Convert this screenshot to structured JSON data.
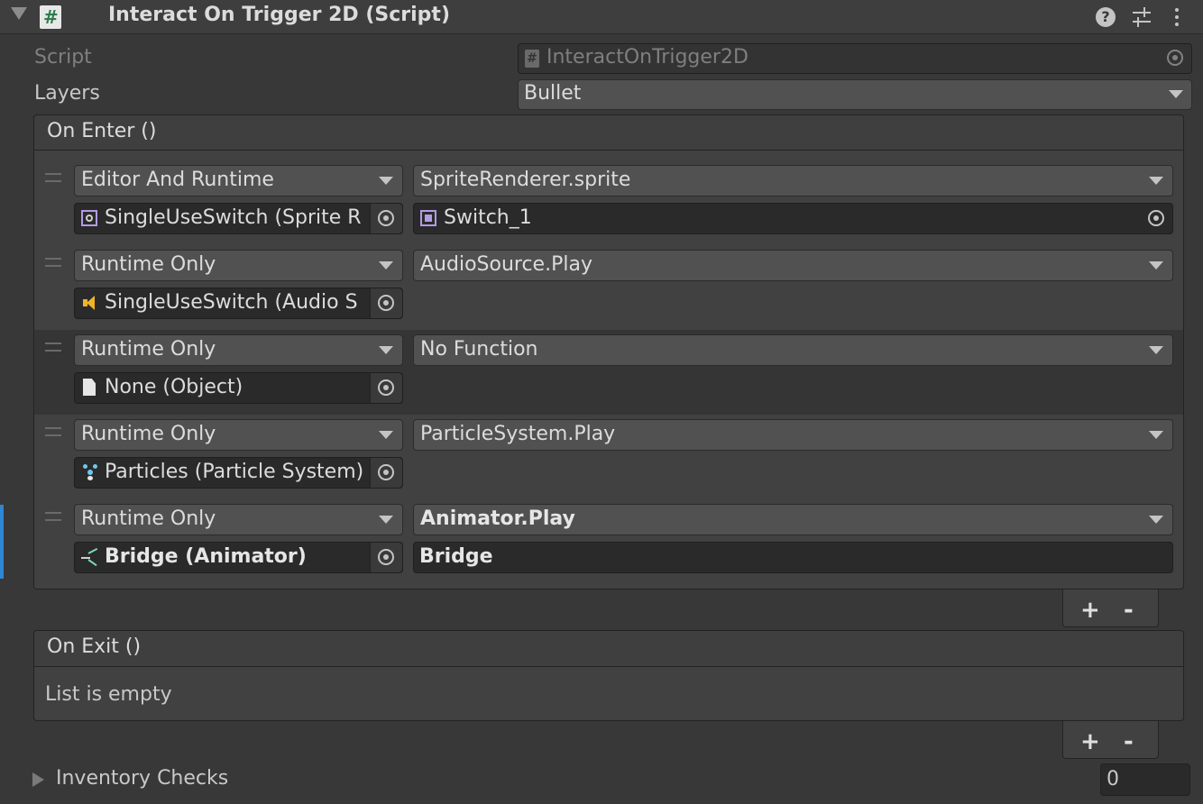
{
  "component": {
    "title": "Interact On Trigger 2D (Script)",
    "icons": {
      "collapse": "triangle-down-icon",
      "script": "csharp-script-icon",
      "help": "help-icon",
      "presets": "sliders-icon",
      "menu": "kebab-menu-icon"
    }
  },
  "fields": {
    "script_label": "Script",
    "script_value": "InteractOnTrigger2D",
    "layers_label": "Layers",
    "layers_value": "Bullet"
  },
  "on_enter": {
    "title": "On Enter ()",
    "events": [
      {
        "runtime": "Editor And Runtime",
        "function": "SpriteRenderer.sprite",
        "target": "SingleUseSwitch (Sprite R",
        "target_icon": "sprite-renderer-icon",
        "arg": "Switch_1",
        "arg_icon": "sprite-icon"
      },
      {
        "runtime": "Runtime Only",
        "function": "AudioSource.Play",
        "target": "SingleUseSwitch (Audio S",
        "target_icon": "audio-source-icon"
      },
      {
        "runtime": "Runtime Only",
        "function": "No Function",
        "target": "None (Object)",
        "target_icon": "document-icon"
      },
      {
        "runtime": "Runtime Only",
        "function": "ParticleSystem.Play",
        "target": "Particles (Particle System)",
        "target_icon": "particle-system-icon"
      },
      {
        "runtime": "Runtime Only",
        "function": "Animator.Play",
        "target": "Bridge (Animator)",
        "target_icon": "animator-icon",
        "arg": "Bridge"
      }
    ],
    "add_label": "+",
    "remove_label": "-"
  },
  "on_exit": {
    "title": "On Exit ()",
    "empty_text": "List is empty",
    "add_label": "+",
    "remove_label": "-"
  },
  "inventory": {
    "label": "Inventory Checks",
    "count": "0"
  },
  "colors": {
    "background": "#383838",
    "selection_bar": "#2f86d4",
    "field": "#2a2a2a",
    "dropdown": "#515151",
    "script_icon": "#4aa56a",
    "sprite_icon": "#b59ae8",
    "audio_icon": "#f0b429",
    "particle_icon": "#6ec6f0",
    "animator_icon": "#7ad8b8"
  }
}
